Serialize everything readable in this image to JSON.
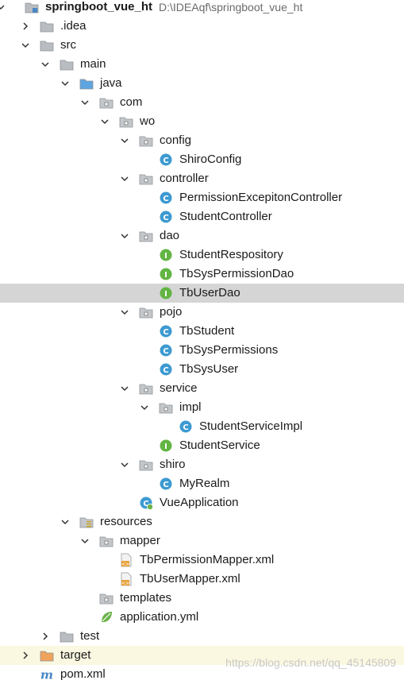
{
  "project": {
    "name": "springboot_vue_ht",
    "path": "D:\\IDEAqf\\springboot_vue_ht"
  },
  "nodes": [
    {
      "id": "root",
      "label": "springboot_vue_ht",
      "icon": "project-folder-icon",
      "expand": "open",
      "depth": 0,
      "bold": true,
      "path": "D:\\IDEAqf\\springboot_vue_ht"
    },
    {
      "id": "idea",
      "label": ".idea",
      "icon": "folder-icon",
      "expand": "closed",
      "depth": 1
    },
    {
      "id": "src",
      "label": "src",
      "icon": "folder-icon",
      "expand": "open",
      "depth": 1
    },
    {
      "id": "main",
      "label": "main",
      "icon": "folder-icon",
      "expand": "open",
      "depth": 2
    },
    {
      "id": "java",
      "label": "java",
      "icon": "source-folder-icon",
      "expand": "open",
      "depth": 3
    },
    {
      "id": "com",
      "label": "com",
      "icon": "package-icon",
      "expand": "open",
      "depth": 4
    },
    {
      "id": "wo",
      "label": "wo",
      "icon": "package-icon",
      "expand": "open",
      "depth": 5
    },
    {
      "id": "config",
      "label": "config",
      "icon": "package-icon",
      "expand": "open",
      "depth": 6
    },
    {
      "id": "shiroconfig",
      "label": "ShiroConfig",
      "icon": "class-icon",
      "expand": "none",
      "depth": 7
    },
    {
      "id": "controller",
      "label": "controller",
      "icon": "package-icon",
      "expand": "open",
      "depth": 6
    },
    {
      "id": "permctrl",
      "label": "PermissionExcepitonController",
      "icon": "class-icon",
      "expand": "none",
      "depth": 7
    },
    {
      "id": "studctrl",
      "label": "StudentController",
      "icon": "class-icon",
      "expand": "none",
      "depth": 7
    },
    {
      "id": "dao",
      "label": "dao",
      "icon": "package-icon",
      "expand": "open",
      "depth": 6
    },
    {
      "id": "studrepo",
      "label": "StudentRespository",
      "icon": "interface-icon",
      "expand": "none",
      "depth": 7
    },
    {
      "id": "permdao",
      "label": "TbSysPermissionDao",
      "icon": "interface-icon",
      "expand": "none",
      "depth": 7
    },
    {
      "id": "userdao",
      "label": "TbUserDao",
      "icon": "interface-icon",
      "expand": "none",
      "depth": 7,
      "selected": true
    },
    {
      "id": "pojo",
      "label": "pojo",
      "icon": "package-icon",
      "expand": "open",
      "depth": 6
    },
    {
      "id": "tbstudent",
      "label": "TbStudent",
      "icon": "class-icon",
      "expand": "none",
      "depth": 7
    },
    {
      "id": "tbsysperm",
      "label": "TbSysPermissions",
      "icon": "class-icon",
      "expand": "none",
      "depth": 7
    },
    {
      "id": "tbsysuser",
      "label": "TbSysUser",
      "icon": "class-icon",
      "expand": "none",
      "depth": 7
    },
    {
      "id": "service",
      "label": "service",
      "icon": "package-icon",
      "expand": "open",
      "depth": 6
    },
    {
      "id": "impl",
      "label": "impl",
      "icon": "package-icon",
      "expand": "open",
      "depth": 7
    },
    {
      "id": "studsvcimpl",
      "label": "StudentServiceImpl",
      "icon": "class-icon",
      "expand": "none",
      "depth": 8
    },
    {
      "id": "studsvc",
      "label": "StudentService",
      "icon": "interface-icon",
      "expand": "none",
      "depth": 7
    },
    {
      "id": "shiro",
      "label": "shiro",
      "icon": "package-icon",
      "expand": "open",
      "depth": 6
    },
    {
      "id": "myrealm",
      "label": "MyRealm",
      "icon": "class-icon",
      "expand": "none",
      "depth": 7
    },
    {
      "id": "vueapp",
      "label": "VueApplication",
      "icon": "spring-boot-class-icon",
      "expand": "none",
      "depth": 6
    },
    {
      "id": "resources",
      "label": "resources",
      "icon": "resources-folder-icon",
      "expand": "open",
      "depth": 3
    },
    {
      "id": "mapper",
      "label": "mapper",
      "icon": "package-icon",
      "expand": "open",
      "depth": 4
    },
    {
      "id": "permmapper",
      "label": "TbPermissionMapper.xml",
      "icon": "xml-file-icon",
      "expand": "none",
      "depth": 5
    },
    {
      "id": "usermapper",
      "label": "TbUserMapper.xml",
      "icon": "xml-file-icon",
      "expand": "none",
      "depth": 5
    },
    {
      "id": "templates",
      "label": "templates",
      "icon": "package-icon",
      "expand": "none",
      "depth": 4
    },
    {
      "id": "appyml",
      "label": "application.yml",
      "icon": "spring-yml-icon",
      "expand": "none",
      "depth": 4
    },
    {
      "id": "test",
      "label": "test",
      "icon": "folder-icon",
      "expand": "closed",
      "depth": 2
    },
    {
      "id": "target",
      "label": "target",
      "icon": "excluded-folder-icon",
      "expand": "closed",
      "depth": 1,
      "highlight": true
    },
    {
      "id": "pom",
      "label": "pom.xml",
      "icon": "maven-icon",
      "expand": "none",
      "depth": 1
    }
  ],
  "watermark": "https://blog.csdn.net/qq_45145809",
  "colors": {
    "selection": "#d5d5d5",
    "target_highlight": "#fbf8e1",
    "class_icon": "#3d9ad1",
    "interface_icon": "#62b543",
    "folder": "#b9bcc0",
    "source_folder": "#5ea4e0",
    "excluded_folder": "#f0a35b"
  }
}
